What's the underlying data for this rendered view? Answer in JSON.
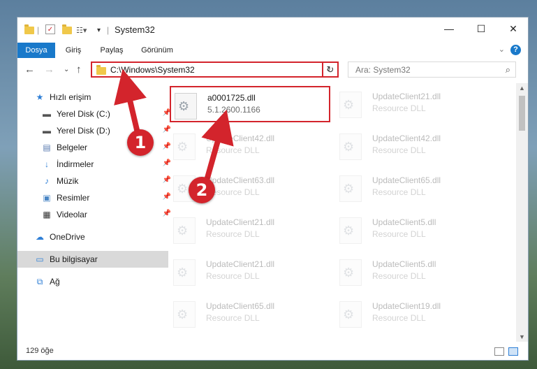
{
  "window": {
    "title": "System32",
    "controls": {
      "minimize": "—",
      "maximize": "☐",
      "close": "✕"
    }
  },
  "ribbon": {
    "tabs": [
      {
        "label": "Dosya",
        "active": true
      },
      {
        "label": "Giriş",
        "active": false
      },
      {
        "label": "Paylaş",
        "active": false
      },
      {
        "label": "Görünüm",
        "active": false
      }
    ],
    "help": "?"
  },
  "nav": {
    "address": "C:\\Windows\\System32",
    "search_placeholder": "Ara: System32"
  },
  "sidebar": {
    "items": [
      {
        "label": "Hızlı erişim",
        "icon": "star-icon",
        "pinned": false
      },
      {
        "label": "Yerel Disk (C:)",
        "icon": "drive-icon",
        "pinned": true
      },
      {
        "label": "Yerel Disk (D:)",
        "icon": "drive-icon",
        "pinned": true
      },
      {
        "label": "Belgeler",
        "icon": "documents-icon",
        "pinned": true
      },
      {
        "label": "İndirmeler",
        "icon": "downloads-icon",
        "pinned": true
      },
      {
        "label": "Müzik",
        "icon": "music-icon",
        "pinned": true
      },
      {
        "label": "Resimler",
        "icon": "pictures-icon",
        "pinned": true
      },
      {
        "label": "Videolar",
        "icon": "videos-icon",
        "pinned": true
      },
      {
        "label": "OneDrive",
        "icon": "cloud-icon",
        "pinned": false
      },
      {
        "label": "Bu bilgisayar",
        "icon": "computer-icon",
        "pinned": false,
        "selected": true
      },
      {
        "label": "Ağ",
        "icon": "network-icon",
        "pinned": false
      }
    ]
  },
  "files": [
    {
      "name": "a0001725.dll",
      "desc": "5.1.2600.1166",
      "highlighted": true
    },
    {
      "name": "UpdateClient21.dll",
      "desc": "Resource DLL"
    },
    {
      "name": "UpdateClient42.dll",
      "desc": "Resource DLL"
    },
    {
      "name": "UpdateClient42.dll",
      "desc": "Resource DLL"
    },
    {
      "name": "UpdateClient63.dll",
      "desc": "Resource DLL"
    },
    {
      "name": "UpdateClient65.dll",
      "desc": "Resource DLL"
    },
    {
      "name": "UpdateClient21.dll",
      "desc": "Resource DLL"
    },
    {
      "name": "UpdateClient5.dll",
      "desc": "Resource DLL"
    },
    {
      "name": "UpdateClient21.dll",
      "desc": "Resource DLL"
    },
    {
      "name": "UpdateClient5.dll",
      "desc": "Resource DLL"
    },
    {
      "name": "UpdateClient65.dll",
      "desc": "Resource DLL"
    },
    {
      "name": "UpdateClient19.dll",
      "desc": "Resource DLL"
    }
  ],
  "status": {
    "count": "129 öğe"
  },
  "annotations": {
    "step1": "1",
    "step2": "2"
  },
  "colors": {
    "accent": "#1979ca",
    "highlight": "#d3242c"
  }
}
